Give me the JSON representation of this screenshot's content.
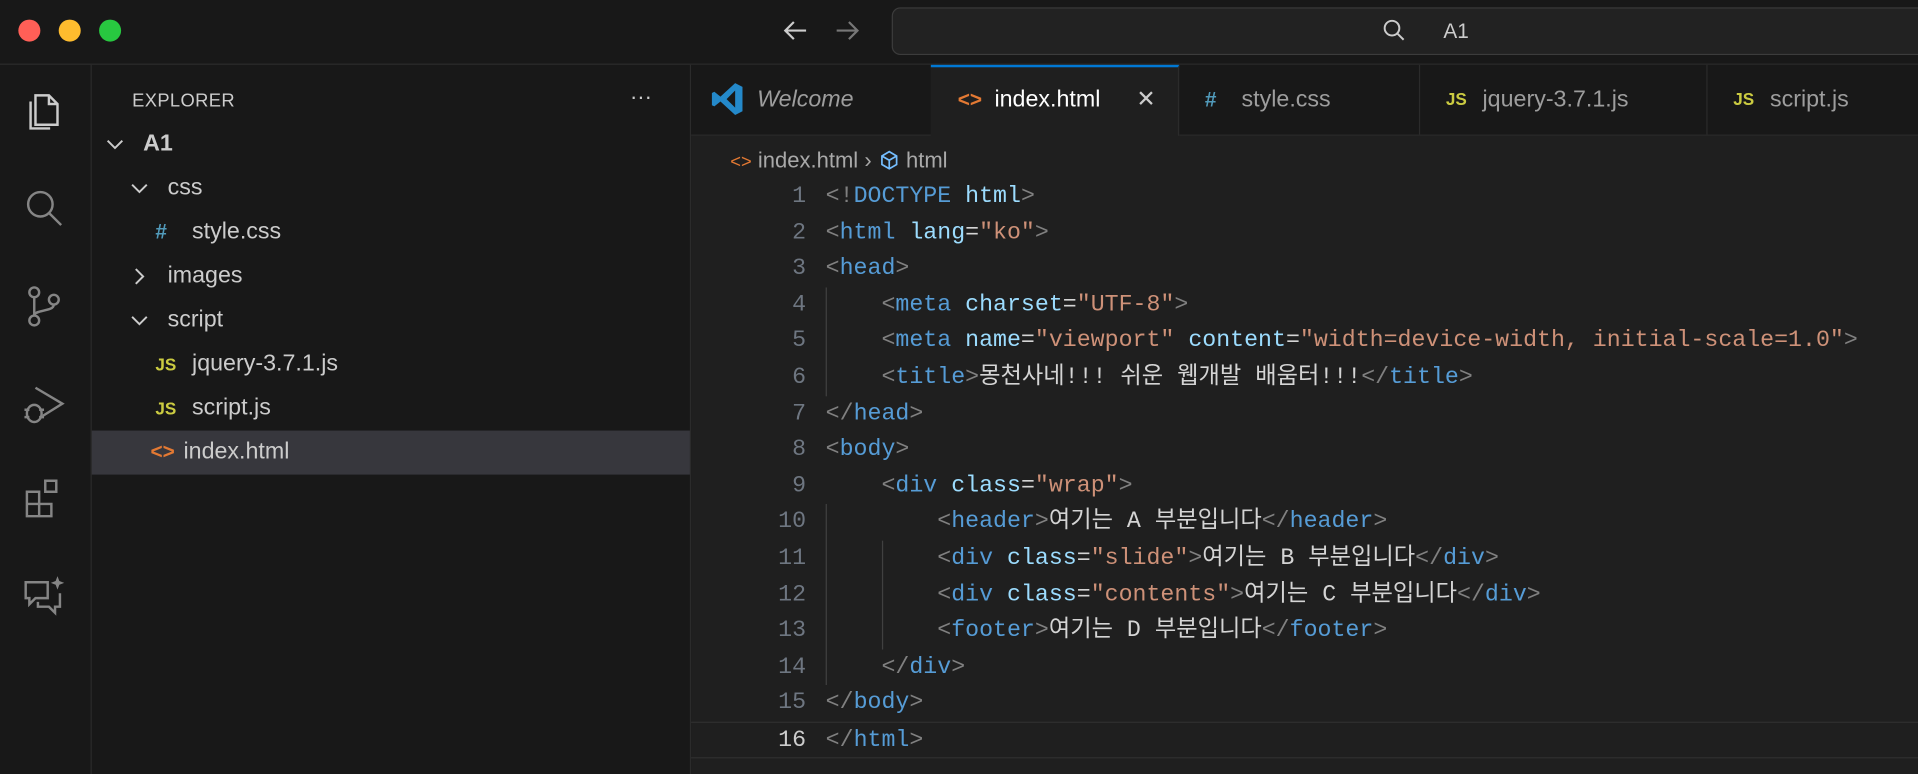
{
  "titlebar": {
    "search_text": "A1",
    "traffic_colors": [
      "#ff5f57",
      "#febc2e",
      "#28c840"
    ]
  },
  "activity": [
    "explorer-icon",
    "search-icon",
    "source-control-icon",
    "run-debug-icon",
    "extensions-icon",
    "chat-icon"
  ],
  "sidebar": {
    "title": "EXPLORER",
    "more": "···",
    "items": [
      {
        "label": "A1",
        "type": "folder-open",
        "depth": 0,
        "bold": true
      },
      {
        "label": "css",
        "type": "folder-open",
        "depth": 1
      },
      {
        "label": "style.css",
        "type": "css",
        "depth": 2
      },
      {
        "label": "images",
        "type": "folder-closed",
        "depth": 1
      },
      {
        "label": "script",
        "type": "folder-open",
        "depth": 1
      },
      {
        "label": "jquery-3.7.1.js",
        "type": "js",
        "depth": 2
      },
      {
        "label": "script.js",
        "type": "js",
        "depth": 2
      },
      {
        "label": "index.html",
        "type": "html",
        "depth": 1,
        "selected": true
      }
    ]
  },
  "tabs": [
    {
      "label": "Welcome",
      "icon": "vscode",
      "italic": true
    },
    {
      "label": "index.html",
      "icon": "html",
      "active": true,
      "close": "✕"
    },
    {
      "label": "style.css",
      "icon": "css"
    },
    {
      "label": "jquery-3.7.1.js",
      "icon": "js"
    },
    {
      "label": "script.js",
      "icon": "js"
    }
  ],
  "icon_text": {
    "js": "JS",
    "css": "#",
    "html": "<>"
  },
  "breadcrumbs": {
    "file": "index.html",
    "sep": "›",
    "symbol": "html"
  },
  "editor": {
    "current_line": 16,
    "lines": [
      [
        [
          "br",
          "<!"
        ],
        [
          "tag",
          "DOCTYPE"
        ],
        [
          "txt",
          " "
        ],
        [
          "attr",
          "html"
        ],
        [
          "br",
          ">"
        ]
      ],
      [
        [
          "br",
          "<"
        ],
        [
          "tag",
          "html"
        ],
        [
          "txt",
          " "
        ],
        [
          "attr",
          "lang"
        ],
        [
          "eq",
          "="
        ],
        [
          "str",
          "\"ko\""
        ],
        [
          "br",
          ">"
        ]
      ],
      [
        [
          "br",
          "<"
        ],
        [
          "tag",
          "head"
        ],
        [
          "br",
          ">"
        ]
      ],
      [
        [
          "txt",
          "    "
        ],
        [
          "br",
          "<"
        ],
        [
          "tag",
          "meta"
        ],
        [
          "txt",
          " "
        ],
        [
          "attr",
          "charset"
        ],
        [
          "eq",
          "="
        ],
        [
          "str",
          "\"UTF-8\""
        ],
        [
          "br",
          ">"
        ]
      ],
      [
        [
          "txt",
          "    "
        ],
        [
          "br",
          "<"
        ],
        [
          "tag",
          "meta"
        ],
        [
          "txt",
          " "
        ],
        [
          "attr",
          "name"
        ],
        [
          "eq",
          "="
        ],
        [
          "str",
          "\"viewport\""
        ],
        [
          "txt",
          " "
        ],
        [
          "attr",
          "content"
        ],
        [
          "eq",
          "="
        ],
        [
          "str",
          "\"width=device-width, initial-scale=1.0\""
        ],
        [
          "br",
          ">"
        ]
      ],
      [
        [
          "txt",
          "    "
        ],
        [
          "br",
          "<"
        ],
        [
          "tag",
          "title"
        ],
        [
          "br",
          ">"
        ],
        [
          "txt",
          "몽천사네!!! 쉬운 웹개발 배움터!!!"
        ],
        [
          "br",
          "</"
        ],
        [
          "tag",
          "title"
        ],
        [
          "br",
          ">"
        ]
      ],
      [
        [
          "br",
          "</"
        ],
        [
          "tag",
          "head"
        ],
        [
          "br",
          ">"
        ]
      ],
      [
        [
          "br",
          "<"
        ],
        [
          "tag",
          "body"
        ],
        [
          "br",
          ">"
        ]
      ],
      [
        [
          "txt",
          "    "
        ],
        [
          "br",
          "<"
        ],
        [
          "tag",
          "div"
        ],
        [
          "txt",
          " "
        ],
        [
          "attr",
          "class"
        ],
        [
          "eq",
          "="
        ],
        [
          "str",
          "\"wrap\""
        ],
        [
          "br",
          ">"
        ]
      ],
      [
        [
          "txt",
          "        "
        ],
        [
          "br",
          "<"
        ],
        [
          "tag",
          "header"
        ],
        [
          "br",
          ">"
        ],
        [
          "txt",
          "여기는 A 부분입니다"
        ],
        [
          "br",
          "</"
        ],
        [
          "tag",
          "header"
        ],
        [
          "br",
          ">"
        ]
      ],
      [
        [
          "txt",
          "        "
        ],
        [
          "br",
          "<"
        ],
        [
          "tag",
          "div"
        ],
        [
          "txt",
          " "
        ],
        [
          "attr",
          "class"
        ],
        [
          "eq",
          "="
        ],
        [
          "str",
          "\"slide\""
        ],
        [
          "br",
          ">"
        ],
        [
          "txt",
          "여기는 B 부분입니다"
        ],
        [
          "br",
          "</"
        ],
        [
          "tag",
          "div"
        ],
        [
          "br",
          ">"
        ]
      ],
      [
        [
          "txt",
          "        "
        ],
        [
          "br",
          "<"
        ],
        [
          "tag",
          "div"
        ],
        [
          "txt",
          " "
        ],
        [
          "attr",
          "class"
        ],
        [
          "eq",
          "="
        ],
        [
          "str",
          "\"contents\""
        ],
        [
          "br",
          ">"
        ],
        [
          "txt",
          "여기는 C 부분입니다"
        ],
        [
          "br",
          "</"
        ],
        [
          "tag",
          "div"
        ],
        [
          "br",
          ">"
        ]
      ],
      [
        [
          "txt",
          "        "
        ],
        [
          "br",
          "<"
        ],
        [
          "tag",
          "footer"
        ],
        [
          "br",
          ">"
        ],
        [
          "txt",
          "여기는 D 부분입니다"
        ],
        [
          "br",
          "</"
        ],
        [
          "tag",
          "footer"
        ],
        [
          "br",
          ">"
        ]
      ],
      [
        [
          "txt",
          "    "
        ],
        [
          "br",
          "</"
        ],
        [
          "tag",
          "div"
        ],
        [
          "br",
          ">"
        ]
      ],
      [
        [
          "br",
          "</"
        ],
        [
          "tag",
          "body"
        ],
        [
          "br",
          ">"
        ]
      ],
      [
        [
          "br",
          "</"
        ],
        [
          "tag",
          "html"
        ],
        [
          "br",
          ">"
        ]
      ]
    ]
  }
}
